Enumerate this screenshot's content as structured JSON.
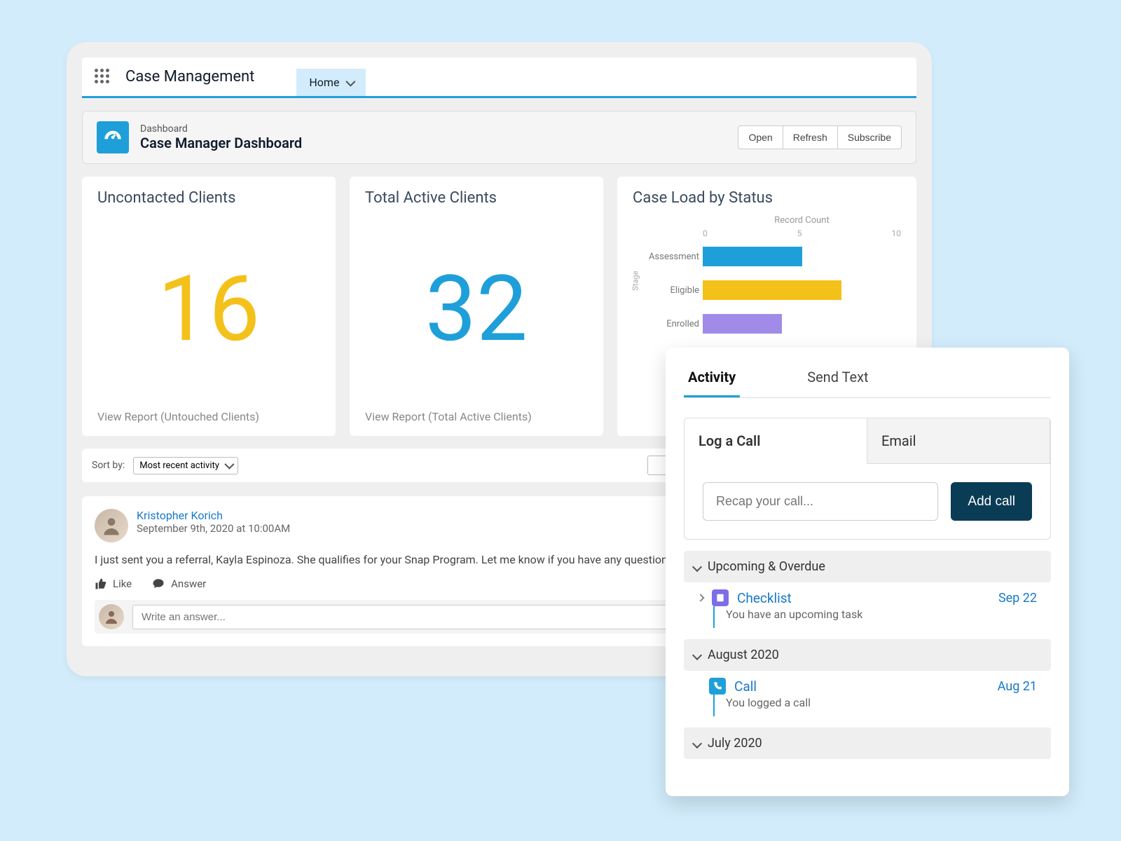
{
  "app_title": "Case Management",
  "nav": {
    "home_label": "Home"
  },
  "dashboard": {
    "subtitle": "Dashboard",
    "title": "Case Manager Dashboard",
    "actions": {
      "open": "Open",
      "refresh": "Refresh",
      "subscribe": "Subscribe"
    }
  },
  "metrics": {
    "uncontacted": {
      "title": "Uncontacted Clients",
      "value": "16",
      "link": "View Report (Untouched Clients)"
    },
    "active": {
      "title": "Total Active Clients",
      "value": "32",
      "link": "View Report (Total Active Clients)"
    }
  },
  "chart_data": {
    "type": "bar",
    "title": "Case Load by Status",
    "xlabel": "Record Count",
    "ylabel": "Stage",
    "x_ticks": [
      "0",
      "5",
      "10"
    ],
    "categories": [
      "Assessment",
      "Eligible",
      "Enrolled"
    ],
    "values": [
      5,
      7,
      4
    ],
    "colors": [
      "#1f9fd9",
      "#f4c11a",
      "#a18be8"
    ],
    "xlim": [
      0,
      10
    ]
  },
  "sort": {
    "label": "Sort by:",
    "selected": "Most recent activity"
  },
  "feed": {
    "author": "Kristopher Korich",
    "timestamp": "September 9th, 2020 at 10:00AM",
    "body": "I just sent you a referral, Kayla Espinoza. She qualifies for your Snap Program. Let me know if you have any questions!",
    "like_label": "Like",
    "answer_label": "Answer",
    "answer_placeholder": "Write an answer..."
  },
  "activity": {
    "tabs": {
      "activity": "Activity",
      "send_text": "Send Text"
    },
    "subtabs": {
      "log_call": "Log a Call",
      "email": "Email"
    },
    "recap_placeholder": "Recap your call...",
    "add_call": "Add call",
    "sections": {
      "upcoming": {
        "title": "Upcoming & Overdue",
        "item_title": "Checklist",
        "item_date": "Sep 22",
        "item_sub": "You have an upcoming task"
      },
      "august": {
        "title": "August 2020",
        "item_title": "Call",
        "item_date": "Aug 21",
        "item_sub": "You logged a call"
      },
      "july": {
        "title": "July 2020"
      }
    }
  }
}
